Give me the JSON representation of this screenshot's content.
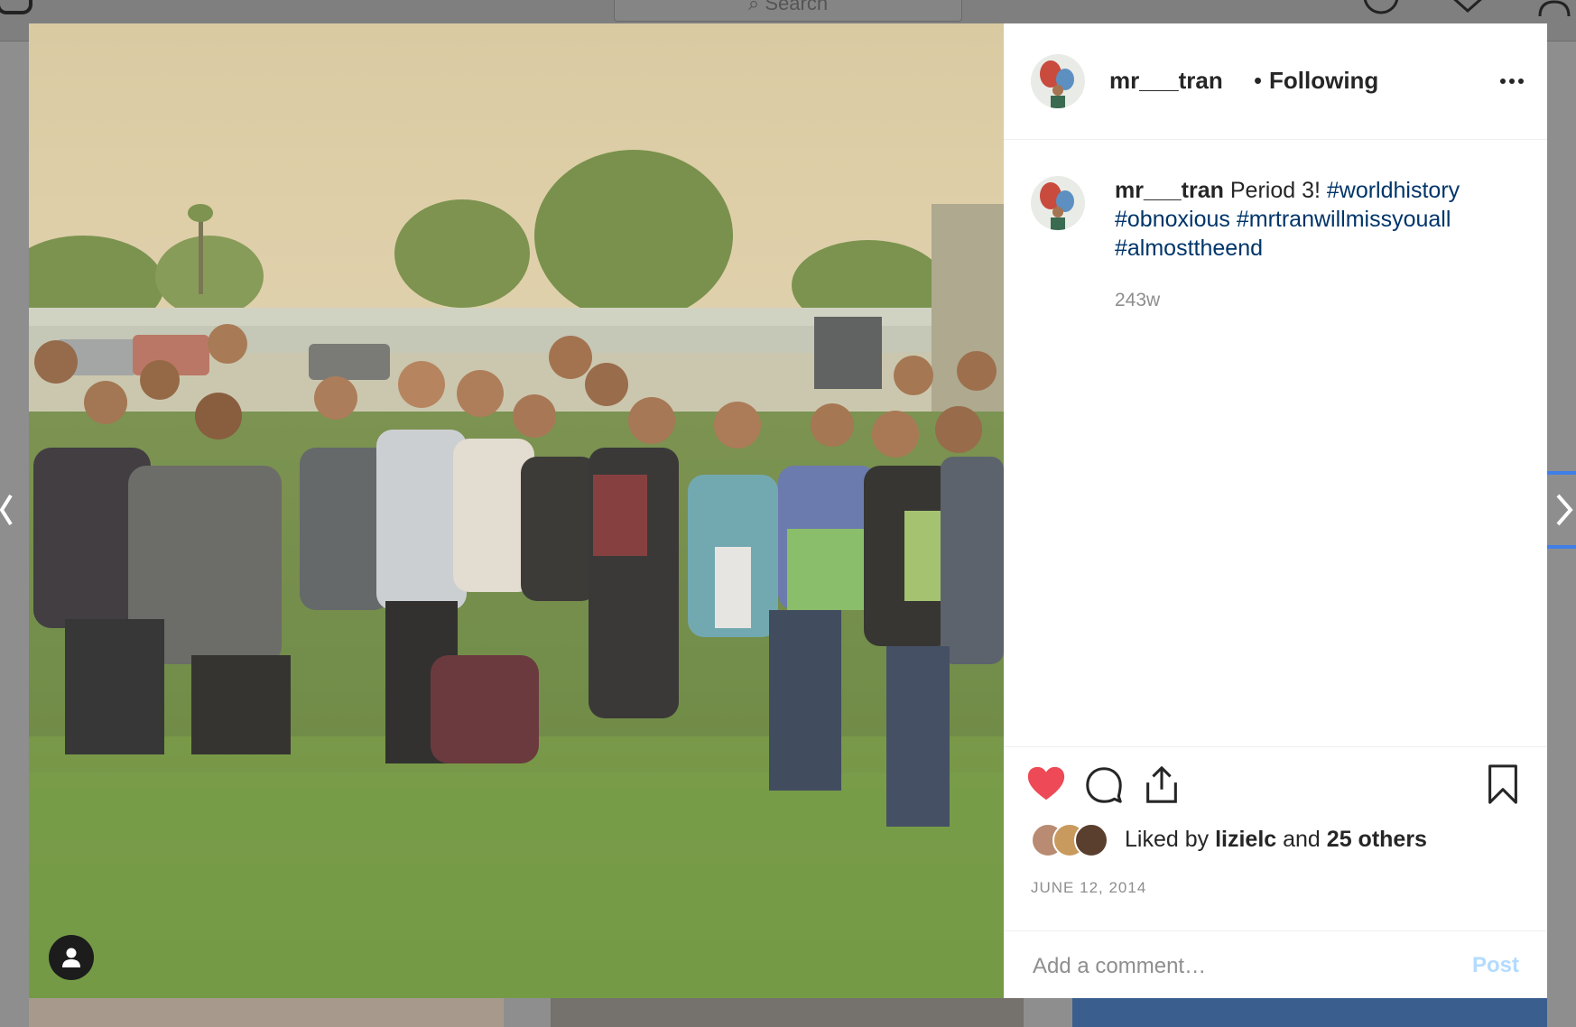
{
  "nav": {
    "search_placeholder": "Search"
  },
  "post": {
    "username": "mr___tran",
    "separator": "•",
    "follow_status": "Following",
    "caption": {
      "username": "mr___tran",
      "text": "Period 3!",
      "hashtags": [
        "#worldhistory",
        "#obnoxious",
        "#mrtranwillmissyouall",
        "#almosttheend"
      ]
    },
    "time_ago": "243w",
    "liked_prefix": "Liked by",
    "liked_user": "lizielc",
    "liked_and": "and",
    "liked_others": "25 others",
    "date": "JUNE 12, 2014",
    "liked": true
  },
  "comment": {
    "placeholder": "Add a comment…",
    "post_label": "Post"
  },
  "icons": {
    "like": "heart-filled-icon",
    "comment": "comment-icon",
    "share": "share-icon",
    "save": "bookmark-icon",
    "more": "more-options-icon",
    "user_tag": "user-tag-icon"
  },
  "colors": {
    "like_red": "#ed4956",
    "hashtag": "#003569",
    "muted": "#8e8e8e",
    "post_disabled": "#b3dbff",
    "nav_highlight": "#3f7fe8"
  }
}
